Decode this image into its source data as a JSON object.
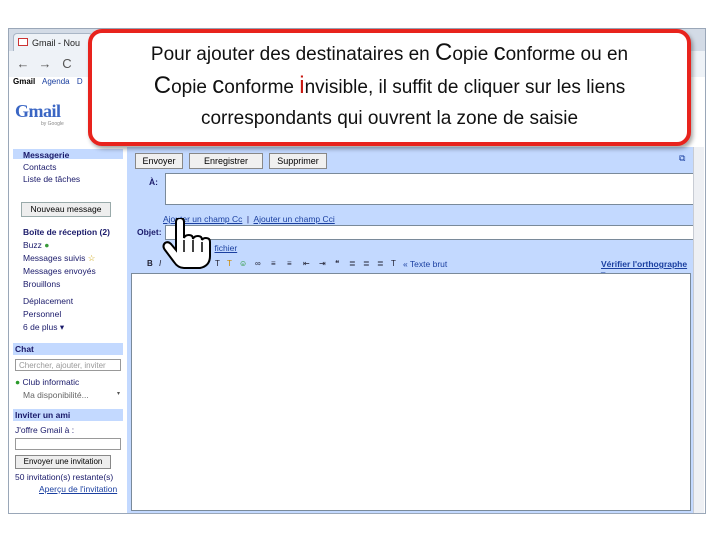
{
  "browser": {
    "tab_title": "Gmail - Nou",
    "nav": {
      "back": "←",
      "forward": "→",
      "reload": "C"
    },
    "gbar": [
      "Gmail",
      "Agenda",
      "D"
    ]
  },
  "logo": {
    "text": "Gmail",
    "sub": "by Google"
  },
  "leftnav": {
    "items_top": [
      "Messagerie",
      "Contacts",
      "Liste de tâches"
    ],
    "compose_label": "Nouveau message",
    "folders": [
      "Boîte de réception (2)",
      "Buzz",
      "Messages suivis",
      "Messages envoyés",
      "Brouillons",
      "Déplacement",
      "Personnel",
      "6 de plus ▾"
    ],
    "chat": {
      "title": "Chat",
      "search_placeholder": "Chercher, ajouter, inviter",
      "contact": "Club informatic",
      "status": "Ma disponibilité..."
    },
    "invite": {
      "title": "Inviter un ami",
      "label": "J'offre Gmail à :",
      "button": "Envoyer une invitation",
      "remaining": "50 invitation(s) restante(s)",
      "preview_link": "Aperçu de l'invitation"
    }
  },
  "compose": {
    "send": "Envoyer",
    "save": "Enregistrer",
    "delete": "Supprimer",
    "to_label": "À:",
    "to_value": "",
    "add_cc": "Ajouter un champ Cc",
    "separator": "|",
    "add_bcc": "Ajouter un champ Cci",
    "subject_label": "Objet:",
    "attach": "fichier",
    "plain_text": "« Texte brut",
    "spellcheck": "Vérifier l'orthographe ▾"
  },
  "callout": {
    "line1_a": "Pour ajouter des destinataires en ",
    "line1_c1": "C",
    "line1_b": "opie ",
    "line1_c2": "c",
    "line1_c": "onforme ou en",
    "line2_c1": "C",
    "line2_a": "opie ",
    "line2_c2": "c",
    "line2_b": "onforme ",
    "line2_c3": "i",
    "line2_c": "nvisible, il suffit de cliquer sur les liens",
    "line3": "correspondants qui ouvrent la zone de saisie"
  },
  "colors": {
    "callout_border": "#e8231d",
    "gmail_blue": "#c3d9ff",
    "link": "#1a3fa0"
  }
}
